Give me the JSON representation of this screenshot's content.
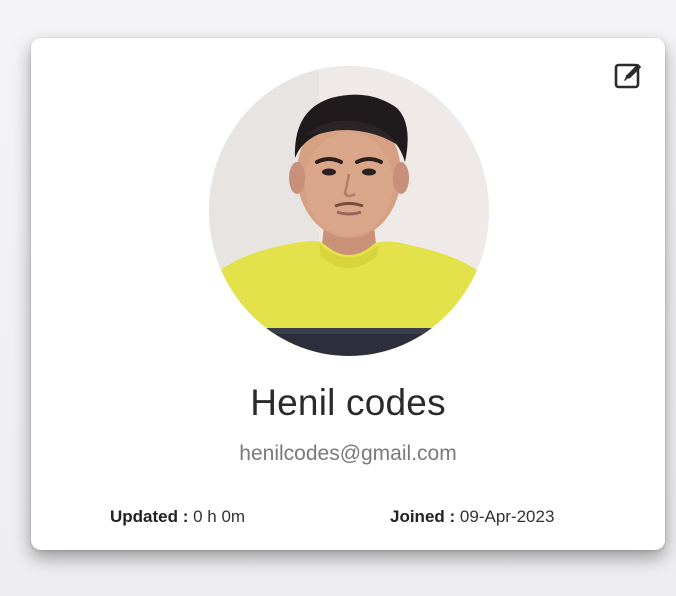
{
  "profile": {
    "name": "Henil codes",
    "email": "henilcodes@gmail.com",
    "updated_label": "Updated :",
    "updated_value": "0 h 0m",
    "joined_label": "Joined :",
    "joined_value": "09-Apr-2023"
  },
  "icons": {
    "edit": "edit-icon",
    "avatar": "profile-photo"
  },
  "colors": {
    "card_bg": "#ffffff",
    "name_text": "#2a2a2a",
    "email_text": "#7a7a7a",
    "shirt": "#e7e544"
  }
}
